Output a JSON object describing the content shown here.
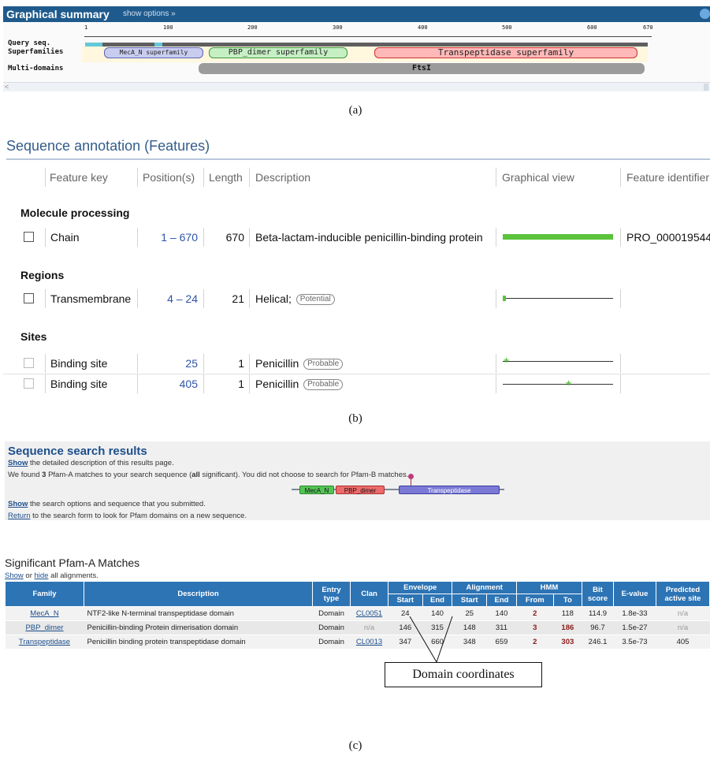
{
  "graphical_summary": {
    "title": "Graphical summary",
    "options_link": "show options »",
    "row_labels": {
      "query": "Query seq.",
      "superfamilies": "Superfamilies",
      "multidomains": "Multi-domains"
    },
    "ruler_ticks": [
      "1",
      "100",
      "200",
      "300",
      "400",
      "500",
      "600",
      "670"
    ],
    "superfamilies": [
      {
        "label": "MecA_N superfamily",
        "color": "#c8cdf0"
      },
      {
        "label": "PBP_dimer superfamily",
        "color": "#c6efc4"
      },
      {
        "label": "Transpeptidase superfamily",
        "color": "#ffb8b8"
      }
    ],
    "multidomain": "FtsI",
    "colors": {
      "header": "#1f5a8c",
      "query_bar": "#5f5f5f",
      "query_highlight": "#66c8d8",
      "multidomain_bar": "#9b9b9b"
    }
  },
  "captions": {
    "a": "(a)",
    "b": "(b)",
    "c": "(c)"
  },
  "sequence_annotation": {
    "title": "Sequence annotation (Features)",
    "headers": [
      "Feature key",
      "Position(s)",
      "Length",
      "Description",
      "Graphical view",
      "Feature identifier"
    ],
    "groups": [
      "Molecule processing",
      "Regions",
      "Sites"
    ],
    "rows": [
      {
        "key": "Chain",
        "position": "1 – 670",
        "length": "670",
        "description": "Beta-lactam-inducible penicillin-binding protein",
        "badge": "",
        "identifier": "PRO_000019544"
      },
      {
        "key": "Transmembrane",
        "position": "4 – 24",
        "length": "21",
        "description": "Helical;",
        "badge": "Potential",
        "identifier": ""
      },
      {
        "key": "Binding site",
        "position": "25",
        "length": "1",
        "description": "Penicillin",
        "badge": "Probable",
        "identifier": ""
      },
      {
        "key": "Binding site",
        "position": "405",
        "length": "1",
        "description": "Penicillin",
        "badge": "Probable",
        "identifier": ""
      }
    ],
    "colors": {
      "title": "#345c8a",
      "chain_bar": "#5cc33c",
      "link": "#2e55a8"
    }
  },
  "search_results": {
    "title": "Sequence search results",
    "line1": {
      "link": "Show",
      "text": " the detailed description of this results page."
    },
    "line2": {
      "pre": "We found ",
      "count": "3",
      "mid": " Pfam-A matches to your search sequence (",
      "all": "all",
      "post": " significant). You did not choose to search for Pfam-B matches."
    },
    "domains": [
      {
        "label": "MecA_N",
        "color": "#55c255"
      },
      {
        "label": "PBP_dimer",
        "color": "#ee6a6a"
      },
      {
        "label": "Transpeptidase",
        "color": "#7a7ad6"
      }
    ],
    "line3": {
      "link": "Show",
      "text": " the search options and sequence that you submitted."
    },
    "line4": {
      "link": "Return",
      "text": " to the search form to look for Pfam domains on a new sequence."
    }
  },
  "pfam_table": {
    "title": "Significant Pfam-A Matches",
    "show": "Show",
    "or": " or ",
    "hide": "hide",
    "all_alignments": " all alignments.",
    "headers": {
      "family": "Family",
      "description": "Description",
      "entry_type": "Entry type",
      "clan": "Clan",
      "envelope": "Envelope",
      "alignment": "Alignment",
      "hmm": "HMM",
      "start": "Start",
      "end": "End",
      "from": "From",
      "to": "To",
      "bit_score": "Bit score",
      "evalue": "E-value",
      "active_site": "Predicted active site"
    },
    "rows": [
      {
        "family": "MecA_N",
        "description": "NTF2-like N-terminal transpeptidase domain",
        "type": "Domain",
        "clan": "CL0051",
        "env_start": "24",
        "env_end": "140",
        "ali_start": "25",
        "ali_end": "140",
        "hmm_from": "2",
        "hmm_to": "118",
        "bit": "114.9",
        "evalue": "1.8e-33",
        "active": "n/a"
      },
      {
        "family": "PBP_dimer",
        "description": "Penicillin-binding Protein dimerisation domain",
        "type": "Domain",
        "clan": "n/a",
        "env_start": "146",
        "env_end": "315",
        "ali_start": "148",
        "ali_end": "311",
        "hmm_from": "3",
        "hmm_to": "186",
        "bit": "96.7",
        "evalue": "1.5e-27",
        "active": "n/a"
      },
      {
        "family": "Transpeptidase",
        "description": "Penicillin binding protein transpeptidase domain",
        "type": "Domain",
        "clan": "CL0013",
        "env_start": "347",
        "env_end": "660",
        "ali_start": "348",
        "ali_end": "659",
        "hmm_from": "2",
        "hmm_to": "303",
        "bit": "246.1",
        "evalue": "3.5e-73",
        "active": "405"
      }
    ],
    "header_color": "#2d74b5"
  },
  "callout": {
    "label": "Domain coordinates"
  }
}
